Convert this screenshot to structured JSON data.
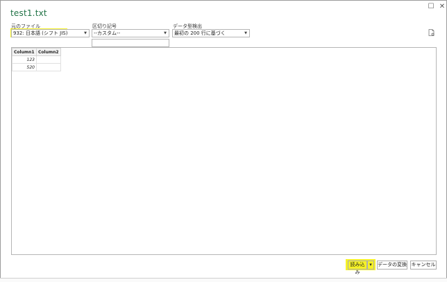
{
  "window": {
    "title": "test1.txt",
    "maximize_icon": "maximize-icon",
    "close_icon": "close-icon",
    "restore_glyph": "☐",
    "close_glyph": "✕"
  },
  "file_origin": {
    "label": "元のファイル",
    "value": "932: 日本語 (シフト JIS)"
  },
  "delimiter": {
    "label": "区切り記号",
    "value": "--カスタム--",
    "custom_value": ""
  },
  "type_detection": {
    "label": "データ型検出",
    "value": "最初の 200 行に基づく"
  },
  "preview": {
    "columns": [
      "Column1",
      "Column2"
    ],
    "rows": [
      [
        "123",
        ""
      ],
      [
        "520",
        ""
      ]
    ]
  },
  "footer": {
    "load_label": "読み込み",
    "load_arrow": "▾",
    "transform_label": "データの変換",
    "cancel_label": "キャンセル"
  },
  "highlight_color": "#f4f000",
  "accent_color": "#217346"
}
